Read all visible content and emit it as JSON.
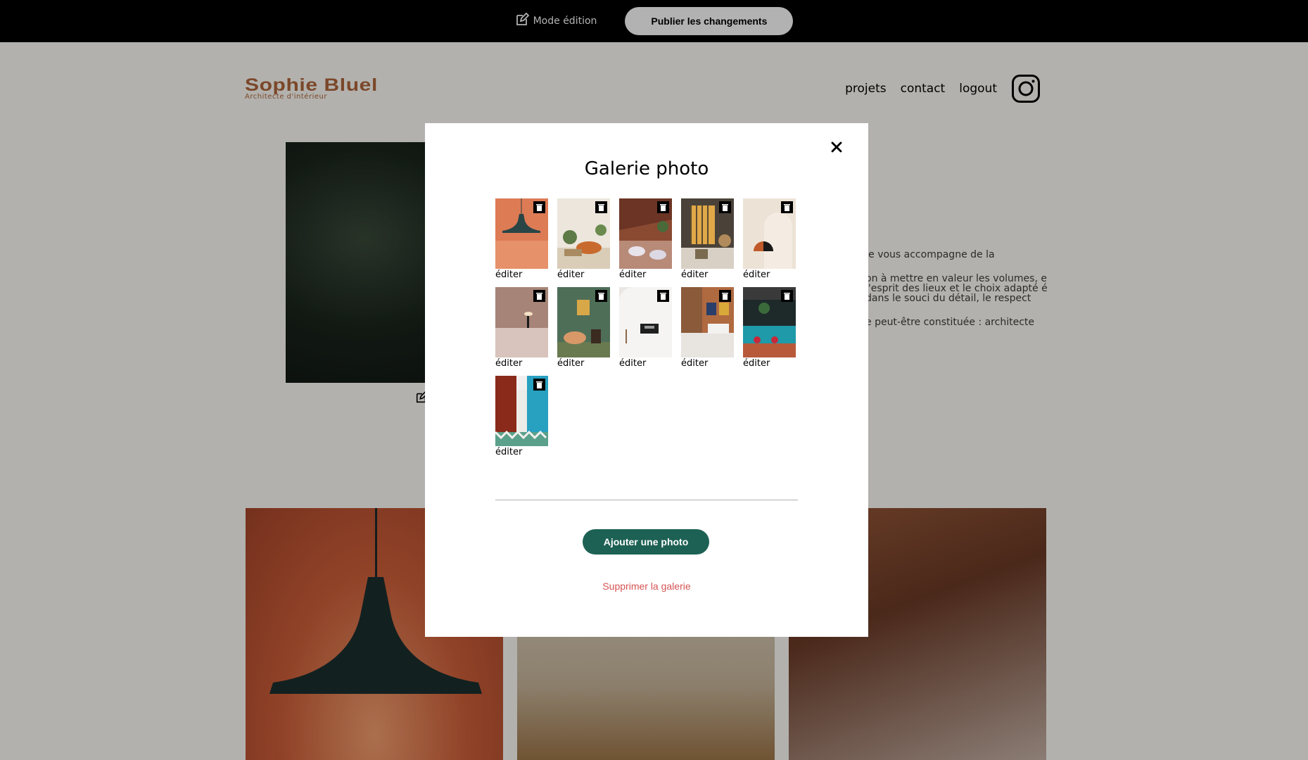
{
  "edit_bar": {
    "mode_label": "Mode édition",
    "publish_label": "Publier les changements"
  },
  "header": {
    "logo_name": "Sophie Bluel",
    "logo_subtitle": "Architecte d'intérieur",
    "nav": [
      "projets",
      "contact",
      "logout"
    ],
    "instagram_icon": "instagram-icon"
  },
  "intro": {
    "paragraphs": [
      "Je vous accompagne de la",
      "on à mettre en valeur les volumes, e l'esprit des lieux et le choix adapté é dans le souci du détail, le respect",
      "e peut-être constituée : architecte"
    ]
  },
  "modal": {
    "title": "Galerie photo",
    "close_icon": "close-icon",
    "trash_icon": "trash-icon",
    "photos": [
      {
        "edit_label": "éditer"
      },
      {
        "edit_label": "éditer"
      },
      {
        "edit_label": "éditer"
      },
      {
        "edit_label": "éditer"
      },
      {
        "edit_label": "éditer"
      },
      {
        "edit_label": "éditer"
      },
      {
        "edit_label": "éditer"
      },
      {
        "edit_label": "éditer"
      },
      {
        "edit_label": "éditer"
      },
      {
        "edit_label": "éditer"
      },
      {
        "edit_label": "éditer"
      }
    ],
    "add_label": "Ajouter une photo",
    "delete_label": "Supprimer la galerie"
  },
  "colors": {
    "accent": "#1d6154",
    "brand": "#b1663c",
    "danger": "#d65353",
    "edit_bar": "#000000"
  }
}
